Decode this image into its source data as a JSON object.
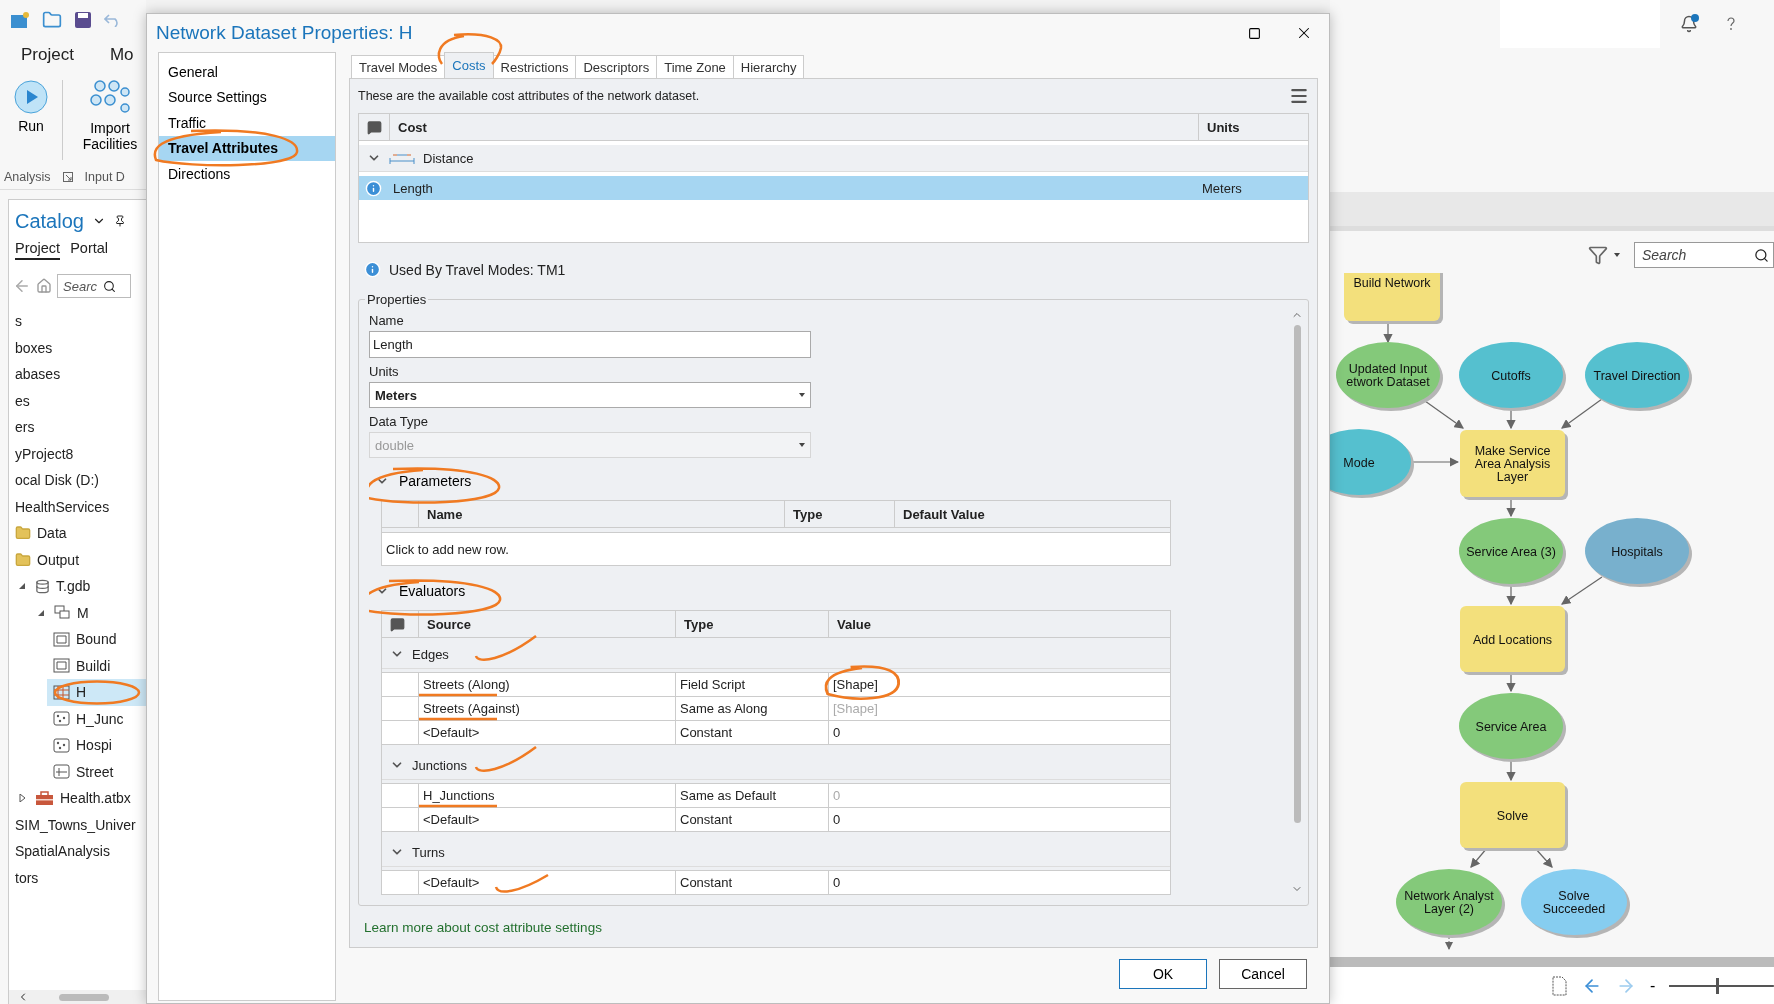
{
  "app": {
    "ribbon_tabs": [
      "Project",
      "Mo"
    ],
    "ribbon_buttons": [
      {
        "kind": "run",
        "label": "Run"
      },
      {
        "kind": "import",
        "label": "Import Facilities"
      }
    ],
    "ribbon_groups": [
      "Analysis",
      "Input D"
    ]
  },
  "catalog": {
    "title": "Catalog",
    "tabs": [
      {
        "label": "Project",
        "selected": true
      },
      {
        "label": "Portal",
        "selected": false
      }
    ],
    "search": {
      "placeholder": "Searc"
    },
    "tree": [
      {
        "label": "s",
        "selected": false
      },
      {
        "label": "boxes",
        "selected": false
      },
      {
        "label": "abases",
        "selected": false
      },
      {
        "label": "es",
        "selected": false
      },
      {
        "label": "ers",
        "selected": false
      },
      {
        "label": "yProject8",
        "selected": false
      },
      {
        "label": "ocal Disk (D:)",
        "selected": false
      },
      {
        "label": "HealthServices",
        "selected": false
      },
      {
        "label": "Data",
        "kind": "folder",
        "selected": false
      },
      {
        "label": "Output",
        "kind": "folder",
        "selected": false
      },
      {
        "label": "T.gdb",
        "kind": "database",
        "expanded": true,
        "selected": false,
        "children": [
          {
            "label": "M",
            "kind": "dataset",
            "expanded": true,
            "selected": false,
            "children": [
              {
                "label": "Bound",
                "kind": "polygon",
                "selected": false
              },
              {
                "label": "Buildi",
                "kind": "polygon",
                "selected": false
              },
              {
                "label": "H",
                "kind": "network",
                "selected": true
              },
              {
                "label": "H_Junc",
                "kind": "points",
                "selected": false
              },
              {
                "label": "Hospi",
                "kind": "points",
                "selected": false
              },
              {
                "label": "Street",
                "kind": "line",
                "selected": false
              }
            ]
          }
        ]
      },
      {
        "label": "Health.atbx",
        "kind": "toolbox",
        "expanded": false,
        "selected": false
      },
      {
        "label": "SIM_Towns_Univer",
        "selected": false
      },
      {
        "label": "SpatialAnalysis",
        "selected": false
      },
      {
        "label": "tors",
        "selected": false
      }
    ]
  },
  "dialog": {
    "title": "Network Dataset Properties: H",
    "nav": [
      {
        "label": "General",
        "selected": false
      },
      {
        "label": "Source Settings",
        "selected": false
      },
      {
        "label": "Traffic",
        "selected": false
      },
      {
        "label": "Travel Attributes",
        "selected": true
      },
      {
        "label": "Directions",
        "selected": false
      }
    ],
    "tabs": [
      {
        "label": "Travel Modes",
        "selected": false
      },
      {
        "label": "Costs",
        "selected": true
      },
      {
        "label": "Restrictions",
        "selected": false
      },
      {
        "label": "Descriptors",
        "selected": false
      },
      {
        "label": "Time Zone",
        "selected": false
      },
      {
        "label": "Hierarchy",
        "selected": false
      }
    ],
    "description": "These are the available cost attributes of the network dataset.",
    "cost_table": {
      "columns": [
        "Cost",
        "Units"
      ],
      "groups": [
        {
          "label": "Distance",
          "expanded": true,
          "rows": [
            {
              "cost": "Length",
              "units": "Meters",
              "selected": true
            }
          ]
        }
      ]
    },
    "used_by": "Used By Travel Modes: TM1",
    "properties": {
      "legend": "Properties",
      "fields": [
        {
          "label": "Name",
          "kind": "text",
          "value": "Length",
          "disabled": false
        },
        {
          "label": "Units",
          "kind": "select",
          "value": "Meters",
          "disabled": false
        },
        {
          "label": "Data Type",
          "kind": "select",
          "value": "double",
          "disabled": true
        }
      ]
    },
    "parameters": {
      "title": "Parameters",
      "expanded": true,
      "columns": [
        "Name",
        "Type",
        "Default Value"
      ],
      "new_row": "Click to add new row."
    },
    "evaluators": {
      "title": "Evaluators",
      "expanded": true,
      "columns": [
        "Source",
        "Type",
        "Value"
      ],
      "groups": [
        {
          "label": "Edges",
          "expanded": true,
          "rows": [
            {
              "source": "Streets (Along)",
              "type": "Field Script",
              "value": "[Shape]",
              "inherited": false
            },
            {
              "source": "Streets (Against)",
              "type": "Same as Along",
              "value": "[Shape]",
              "inherited": true
            },
            {
              "source": "<Default>",
              "type": "Constant",
              "value": "0",
              "inherited": false
            }
          ]
        },
        {
          "label": "Junctions",
          "expanded": true,
          "rows": [
            {
              "source": "H_Junctions",
              "type": "Same as Default",
              "value": "0",
              "inherited": true
            },
            {
              "source": "<Default>",
              "type": "Constant",
              "value": "0",
              "inherited": false
            }
          ]
        },
        {
          "label": "Turns",
          "expanded": true,
          "rows": [
            {
              "source": "<Default>",
              "type": "Constant",
              "value": "0",
              "inherited": false
            }
          ]
        }
      ]
    },
    "link": "Learn more about cost attribute settings",
    "buttons": [
      {
        "label": "OK",
        "default": true
      },
      {
        "label": "Cancel",
        "default": false
      }
    ]
  },
  "model": {
    "search": {
      "placeholder": "Search"
    },
    "zoom_out": "-",
    "zoom": {
      "level": 0.45
    },
    "nodes": [
      {
        "kind": "process",
        "lines": [
          "Build Network"
        ],
        "color": "#f3e07c"
      },
      {
        "kind": "data",
        "lines": [
          "Updated Input",
          "etwork Dataset"
        ],
        "color": "#84c97a"
      },
      {
        "kind": "data",
        "lines": [
          "Cutoffs"
        ],
        "color": "#55c0cf"
      },
      {
        "kind": "data",
        "lines": [
          "Travel Direction"
        ],
        "color": "#55c0cf"
      },
      {
        "kind": "data",
        "lines": [
          "Mode"
        ],
        "color": "#55c0cf"
      },
      {
        "kind": "process",
        "lines": [
          "Make Service",
          "Area Analysis",
          "Layer"
        ],
        "color": "#f3e07c"
      },
      {
        "kind": "data",
        "lines": [
          "Service Area (3)"
        ],
        "color": "#84c97a"
      },
      {
        "kind": "data",
        "lines": [
          "Hospitals"
        ],
        "color": "#78b0cd"
      },
      {
        "kind": "process",
        "lines": [
          "Add Locations"
        ],
        "color": "#f3e07c"
      },
      {
        "kind": "data",
        "lines": [
          "Service Area"
        ],
        "color": "#84c97a"
      },
      {
        "kind": "process",
        "lines": [
          "Solve"
        ],
        "color": "#f3e07c"
      },
      {
        "kind": "data",
        "lines": [
          "Network Analyst",
          "Layer (2)"
        ],
        "color": "#84c97a"
      },
      {
        "kind": "data",
        "lines": [
          "Solve",
          "Succeeded"
        ],
        "color": "#86cdf0"
      }
    ]
  }
}
